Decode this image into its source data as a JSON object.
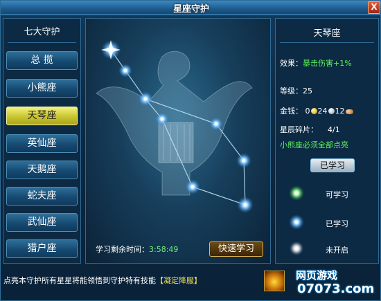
{
  "window": {
    "title": "星座守护",
    "close_label": "X"
  },
  "nav": {
    "header": "七大守护",
    "items": [
      {
        "label": "总  揽",
        "active": false
      },
      {
        "label": "小熊座",
        "active": false
      },
      {
        "label": "天琴座",
        "active": true
      },
      {
        "label": "英仙座",
        "active": false
      },
      {
        "label": "天鹅座",
        "active": false
      },
      {
        "label": "蛇夫座",
        "active": false
      },
      {
        "label": "武仙座",
        "active": false
      },
      {
        "label": "猎户座",
        "active": false
      }
    ]
  },
  "sky": {
    "timer_label": "学习剩余时间：",
    "timer_value": "3:58:49",
    "learn_fast_label": "快速学习"
  },
  "info": {
    "title": "天琴座",
    "effect_label": "效果：",
    "effect_value": "暴击伤害+1%",
    "level_label": "等级：",
    "level_value": "25",
    "money_label": "金钱：",
    "money_gold": "0",
    "money_silver": "24",
    "money_copper": "12",
    "fragment_label": "星辰碎片：",
    "fragment_value": "4/1",
    "requirement": "小熊座必须全部点亮",
    "learned_button": "已学习",
    "legend": [
      {
        "label": "可学习",
        "color": "#7cf07a"
      },
      {
        "label": "已学习",
        "color": "#6fb8ff"
      },
      {
        "label": "未开启",
        "color": "#cfd6dc"
      }
    ]
  },
  "footer": {
    "text": "点亮本守护所有星星将能领悟到守护特有技能",
    "skill_name": "【凝定降服】"
  },
  "logo": {
    "top": "网页游戏",
    "bottom": "07073.com"
  }
}
